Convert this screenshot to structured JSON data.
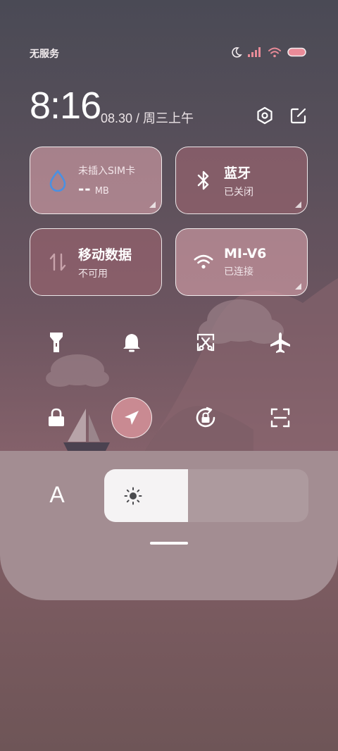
{
  "status": {
    "carrier": "无服务",
    "icons": [
      "moon-icon",
      "signal-icon",
      "wifi-icon",
      "battery-icon"
    ]
  },
  "header": {
    "time": "8:16",
    "date": "08.30 / 周三上午",
    "icons": [
      "settings-icon",
      "edit-icon"
    ]
  },
  "tiles": {
    "data": {
      "title": "未插入SIM卡",
      "value": "--",
      "unit": "MB",
      "icon": "water-drop-icon"
    },
    "bluetooth": {
      "title": "蓝牙",
      "status": "已关闭",
      "icon": "bluetooth-icon"
    },
    "mobile": {
      "title": "移动数据",
      "status": "不可用",
      "icon": "data-arrows-icon"
    },
    "wifi": {
      "title": "MI-V6",
      "status": "已连接",
      "icon": "wifi-icon"
    }
  },
  "toggles_row1": [
    "flashlight-icon",
    "bell-icon",
    "screenshot-icon",
    "airplane-icon"
  ],
  "toggles_row2": [
    "lock-icon",
    "location-icon",
    "rotation-lock-icon",
    "scan-icon"
  ],
  "brightness": {
    "auto_label": "A",
    "level_fraction": 0.41
  },
  "colors": {
    "accent_blue": "#4a90e2",
    "tile_light": "#d7a0aa",
    "tile_dark": "#96626e",
    "panel": "#a38d92"
  }
}
